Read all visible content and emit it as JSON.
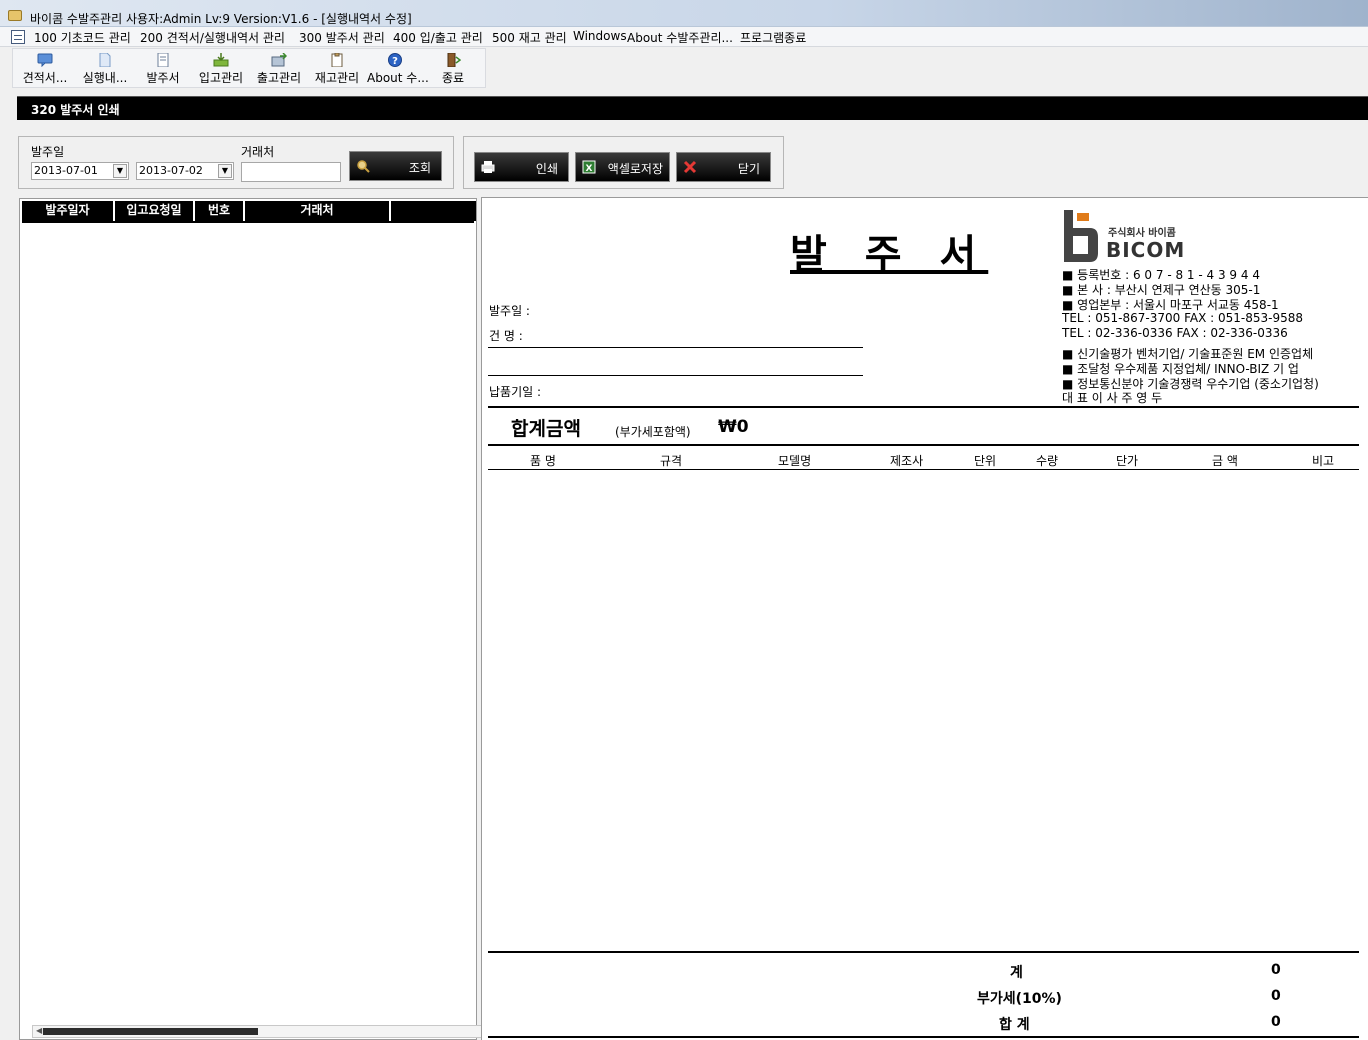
{
  "window": {
    "title": "바이콤 수발주관리 사용자:Admin Lv:9  Version:V1.6 - [실행내역서 수정]"
  },
  "menu": {
    "items": [
      "100 기초코드 관리",
      "200 견적서/실행내역서 관리",
      "300 발주서 관리",
      "400 입/출고 관리",
      "500 재고 관리",
      "Windows",
      "About 수발주관리...",
      "프로그램종료"
    ]
  },
  "toolbar": {
    "buttons": [
      {
        "label": "견적서...",
        "icon": "chat-icon"
      },
      {
        "label": "실행내...",
        "icon": "document-icon"
      },
      {
        "label": "발주서",
        "icon": "page-icon"
      },
      {
        "label": "입고관리",
        "icon": "inbox-icon"
      },
      {
        "label": "출고관리",
        "icon": "outbox-icon"
      },
      {
        "label": "재고관리",
        "icon": "clipboard-icon"
      },
      {
        "label": "About 수...",
        "icon": "help-icon"
      },
      {
        "label": "종료",
        "icon": "exit-door-icon"
      }
    ]
  },
  "form": {
    "title": "320 발주서 인쇄"
  },
  "filter": {
    "order_date_label": "발주일",
    "date_from": "2013-07-01",
    "date_to": "2013-07-02",
    "vendor_label": "거래처",
    "vendor_value": "",
    "search_label": "조회"
  },
  "actions": {
    "print_label": "인쇄",
    "excel_label": "액셀로저장",
    "close_label": "닫기"
  },
  "list": {
    "columns": [
      "발주일자",
      "입고요청일",
      "번호",
      "거래처",
      ""
    ]
  },
  "report": {
    "title": "발 주 서",
    "company": {
      "logo_small": "주식회사 바이콤",
      "logo_name": "BICOM",
      "lines": [
        "■ 등록번호  : 6 0 7 - 8 1 - 4 3 9 4 4",
        "■ 본      사  : 부산시 연제구 연산동 305-1",
        "■ 영업본부  : 서울시 마포구 서교동 458-1",
        "     TEL : 051-867-3700     FAX : 051-853-9588",
        "     TEL :  02-336-0336      FAX :  02-336-0336",
        "■ 신기술평가 벤처기업/ 기술표준원 EM  인증업체",
        "■ 조달청 우수제품 지정업체/  INNO-BIZ   기  업",
        "■ 정보통신분야 기술경쟁력 우수기업 (중소기업청)",
        "            대  표  이  사     주    영    두"
      ]
    },
    "order_date_label": "발주일 :",
    "subject_label": "건    명 :",
    "supplier_label": "납품기일 :",
    "total_label": "합계금액",
    "vat_note": "(부가세포함액)",
    "total_value": "₩0",
    "columns": [
      "품      명",
      "규격",
      "모델명",
      "제조사",
      "단위",
      "수량",
      "단가",
      "금    액",
      "비고"
    ],
    "summary": [
      {
        "label": "계",
        "value": "0"
      },
      {
        "label": "부가세(10%)",
        "value": "0"
      },
      {
        "label": "합  계",
        "value": "0"
      }
    ]
  }
}
